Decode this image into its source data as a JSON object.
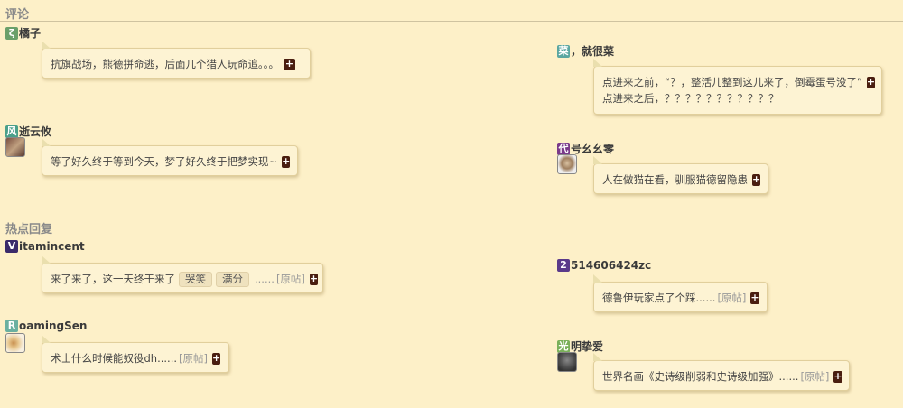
{
  "sections": {
    "comments": "评论",
    "hot": "热点回复"
  },
  "comments": [
    {
      "badge": "ζ",
      "badge_color": "#6aa06a",
      "name": "橘子",
      "text": "抗旗战场，熊德拼命逃，后面几个猎人玩命追。。。"
    },
    {
      "badge": "菜",
      "badge_color": "#5aa6a0",
      "name": "，就很菜",
      "line1": "点进来之前，“？，整活儿整到这儿来了，倒霉蛋号没了”",
      "line2": "点进来之后，？？？？？？？？？？？"
    },
    {
      "badge": "风",
      "badge_color": "#4aa08a",
      "name": "逝云攸",
      "text": "等了好久终于等到今天，梦了好久终于把梦实现~"
    },
    {
      "badge": "代",
      "badge_color": "#7a3a8a",
      "name": "号幺幺零",
      "text": "人在做猫在看，驯服猫德留隐患"
    }
  ],
  "hot": [
    {
      "badge": "V",
      "badge_color": "#3a2a6a",
      "name": "itamincent",
      "text": "来了来了，这一天终于来了",
      "tags": [
        "哭笑",
        "满分"
      ],
      "ellipsis": "......",
      "orig": "[原帖]"
    },
    {
      "badge": "2",
      "badge_color": "#5a3a8a",
      "name": "514606424zc",
      "text": "德鲁伊玩家点了个踩......",
      "orig": "[原帖]"
    },
    {
      "badge": "R",
      "badge_color": "#6ab0a0",
      "name": "oamingSen",
      "text": "术士什么时候能奴役dh......",
      "orig": "[原帖]"
    },
    {
      "badge": "光",
      "badge_color": "#7ab05a",
      "name": "明挚爱",
      "text": "世界名画《史诗级削弱和史诗级加强》......",
      "orig": "[原帖]"
    }
  ],
  "icons": {
    "plus": "+"
  }
}
